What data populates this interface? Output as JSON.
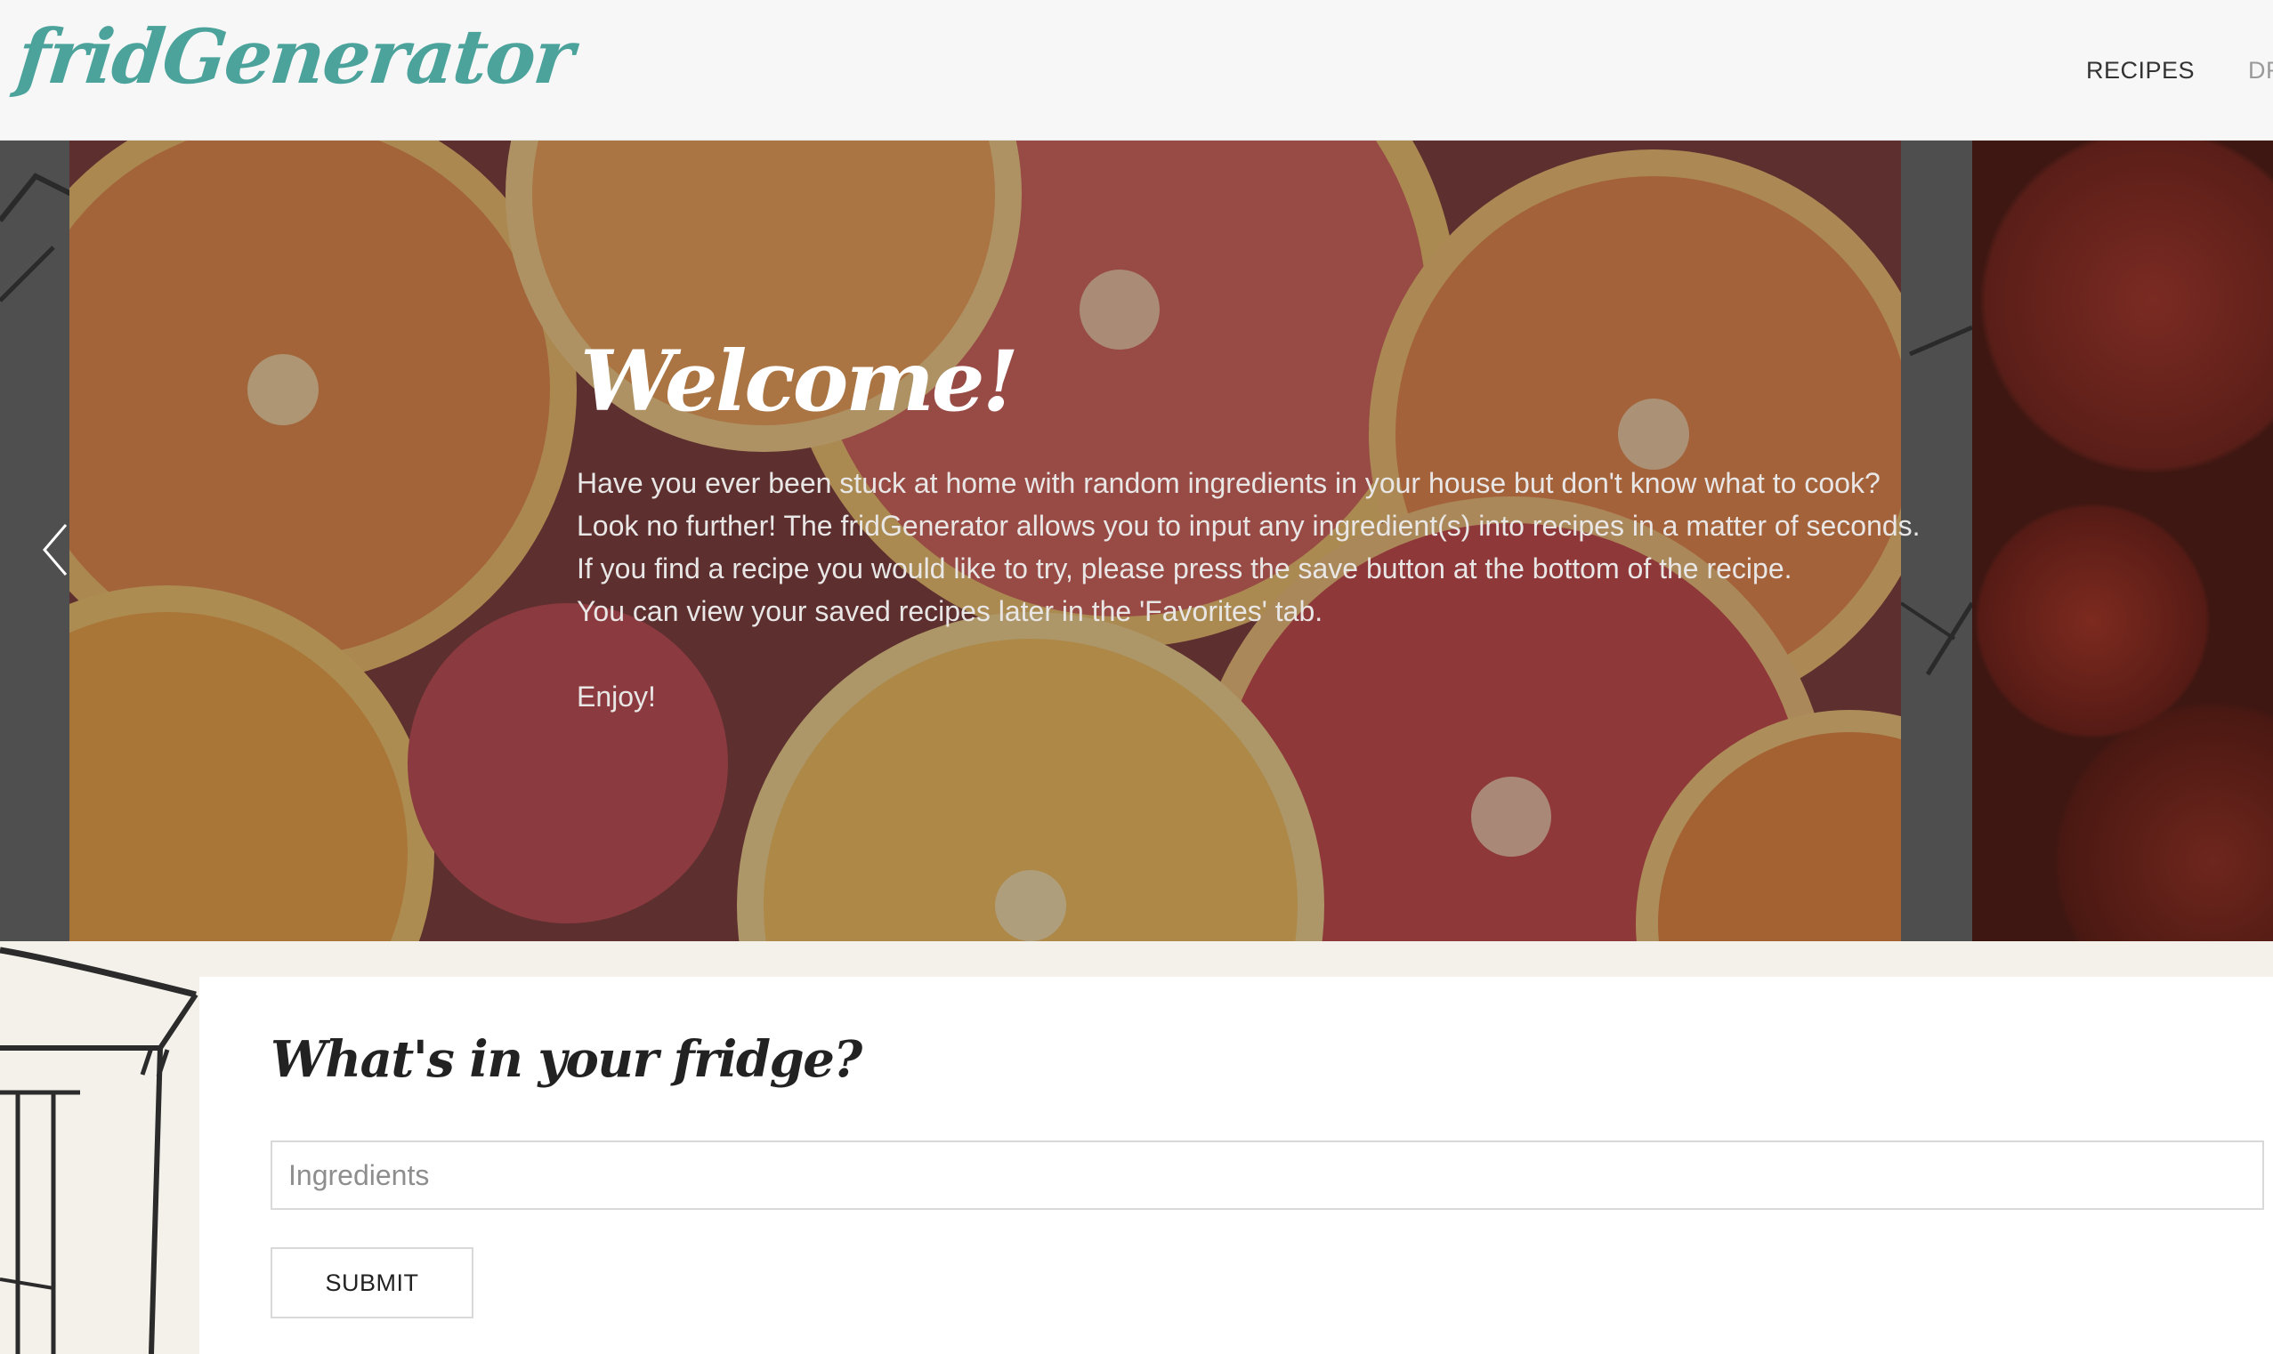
{
  "brand": {
    "name": "fridGenerator",
    "color": "#4ba39c"
  },
  "nav": {
    "items": [
      "RECIPES",
      "DRI"
    ]
  },
  "hero": {
    "title": "Welcome!",
    "lines": [
      "Have you ever been stuck at home with random ingredients in your house but don't know what to cook?",
      "Look no further! The fridGenerator allows you to input any ingredient(s) into recipes in a matter of seconds.",
      "If you find a recipe you would like to try, please press the save button at the bottom of the recipe.",
      "You can view your saved recipes later in the 'Favorites' tab."
    ],
    "enjoy": "Enjoy!",
    "prev_icon": "chevron-left-icon"
  },
  "fridge_form": {
    "title": "What's in your fridge?",
    "input_placeholder": "Ingredients",
    "input_value": "",
    "submit_label": "SUBMIT"
  }
}
